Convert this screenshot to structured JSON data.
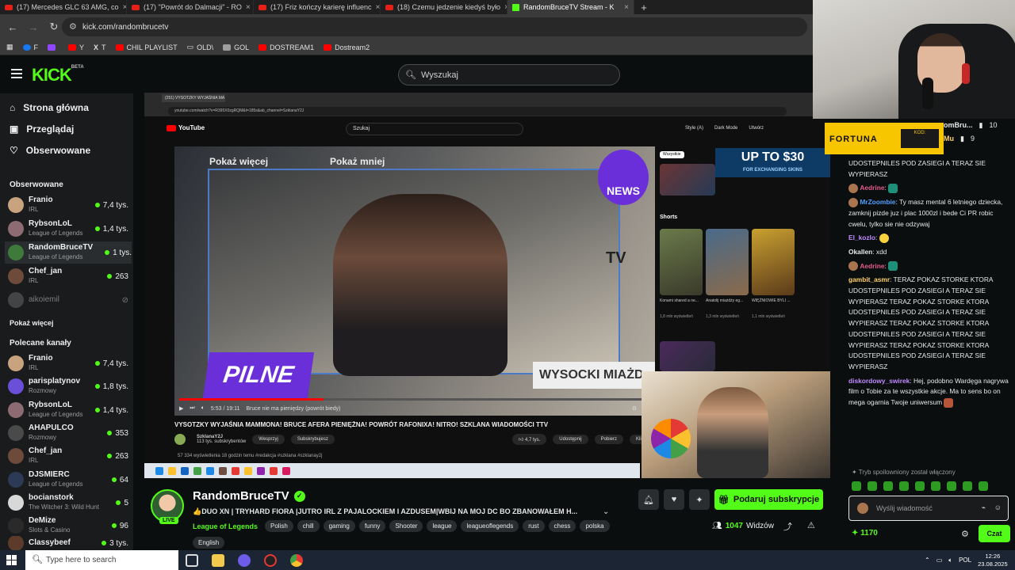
{
  "browser": {
    "tabs": [
      {
        "title": "(17) Mercedes GLC 63 AMG, co",
        "icon": "youtube"
      },
      {
        "title": "(17) \"Powrót do Dalmacji\" - RO",
        "icon": "youtube"
      },
      {
        "title": "(17) Friz kończy karierę influenc",
        "icon": "youtube"
      },
      {
        "title": "(18) Czemu jedzenie kiedyś było",
        "icon": "youtube"
      },
      {
        "title": "RandomBruceTV Stream - K",
        "icon": "kick"
      }
    ],
    "url": "kick.com/randombrucetv",
    "bookmarks": [
      {
        "label": "F",
        "color": "#1877f2"
      },
      {
        "label": "",
        "color": "#9146ff"
      },
      {
        "label": "Y",
        "color": "#ff0000"
      },
      {
        "label": "T",
        "color": "#ffffff"
      },
      {
        "label": "CHIL PLAYLIST",
        "color": "#ff0000"
      },
      {
        "label": "OLD\\",
        "color": "#cfcfcf"
      },
      {
        "label": "GOL",
        "color": "#9e9e9e"
      },
      {
        "label": "DOSTREAM1",
        "color": "#ff0000"
      },
      {
        "label": "Dostream2",
        "color": "#ff0000"
      }
    ]
  },
  "kick": {
    "logo": "KICK",
    "logo_sup": "BETA",
    "search_placeholder": "Wyszukaj",
    "nav": {
      "home": "Strona główna",
      "browse": "Przeglądaj",
      "following": "Obserwowane"
    },
    "followed_title": "Obserwowane",
    "followed": [
      {
        "name": "Franio",
        "category": "IRL",
        "viewers": "7,4 tys.",
        "live": true
      },
      {
        "name": "RybsonLoL",
        "category": "League of Legends",
        "viewers": "1,4 tys.",
        "live": true
      },
      {
        "name": "RandomBruceTV",
        "category": "League of Legends",
        "viewers": "1 tys.",
        "live": true
      },
      {
        "name": "Chef_jan",
        "category": "IRL",
        "viewers": "263",
        "live": true
      },
      {
        "name": "aikoiemil",
        "category": "",
        "viewers": "",
        "live": false
      }
    ],
    "show_more": "Pokaż więcej",
    "recommended_title": "Polecane kanały",
    "recommended": [
      {
        "name": "Franio",
        "category": "IRL",
        "viewers": "7,4 tys."
      },
      {
        "name": "parisplatynov",
        "category": "Rozmowy",
        "viewers": "1,8 tys."
      },
      {
        "name": "RybsonLoL",
        "category": "League of Legends",
        "viewers": "1,4 tys."
      },
      {
        "name": "AHAPULCO",
        "category": "Rozmowy",
        "viewers": "353"
      },
      {
        "name": "Chef_jan",
        "category": "IRL",
        "viewers": "263"
      },
      {
        "name": "DJSMIERC",
        "category": "League of Legends",
        "viewers": "64"
      },
      {
        "name": "bocianstork",
        "category": "The Witcher 3: Wild Hunt",
        "viewers": "5"
      },
      {
        "name": "DeMize",
        "category": "Slots & Casino",
        "viewers": "96"
      },
      {
        "name": "Classybeef",
        "category": "",
        "viewers": "3 tys."
      }
    ]
  },
  "video": {
    "inner_tab": "(251) VYSOTZKY WYJAŚNIA MA",
    "inner_url": "youtube.com/watch?v=R395X0zgRQM&t=185s&ab_channel=SzklanaY2J",
    "yt_search": "Szukaj",
    "yt_menu": [
      "Style (A)",
      "Dark Mode",
      "Utwórz"
    ],
    "pokaz_wiecej": "Pokaż więcej",
    "pokaz_mniej": "Pokaż mniej",
    "news": "NEWS",
    "tv": "TV",
    "pilne": "PILNE",
    "banner": "WYSOCKI MIAŻD",
    "time": "5:53 / 19:11",
    "chapter": "Bruce nie ma pieniędzy (powrót biedy)",
    "progress": 0.31,
    "title": "VYSOTZKY WYJAŚNIA MAMMONA! BRUCE AFERA PIENIĘŻNA! POWRÓT RAFONIXA! NITRO! SZKLANA WIADOMOŚCI TTV",
    "channel": "SzklanaY2J",
    "channel_subs": "113 tys. subskrybentów",
    "join": "Wesprzyj",
    "subscribed": "Subskrybujesz",
    "likes": "4,7 tys.",
    "share": "Udostępnij",
    "download": "Pobierz",
    "clip": "Klip",
    "views_line": "57 334 wyświetlenia  18 godzin temu  #redakcja #szklana #szklanay2j",
    "side_chip": "Wszystkie",
    "shorts": "Shorts",
    "short_titles": [
      "Konami shared a ne...",
      "Anatolij miażdży eg...",
      "WIĘŹNIOWIE BYLI ..."
    ],
    "short_views": [
      "1,8 mln wyświetleń",
      "1,3 mln wyświetleń",
      "1,1 mln wyświetleń"
    ],
    "promo_big": "UP TO $30",
    "promo_small": "FOR EXCHANGING SKINS"
  },
  "stream": {
    "name": "RandomBruceTV",
    "live": "LIVE",
    "title": "👍DUO XN | TRYHARD FIORA |JUTRO IRL Z PAJALOCKIEM I AZDUSEM|WBIJ NA MOJ DC BO ZBANOWAŁEM H...",
    "category": "League of Legends",
    "tags": [
      "Polish",
      "chill",
      "gaming",
      "funny",
      "Shooter",
      "league",
      "leagueoflegends",
      "rust",
      "chess",
      "polska",
      "English"
    ],
    "subscribe_button": "Podaruj subskrypcje",
    "viewers_count": "1047",
    "viewers_label": "Widzów"
  },
  "chat": {
    "top": [
      {
        "user": "omBru...",
        "badge": "10"
      },
      {
        "user": "Mu",
        "badge": "9"
      }
    ],
    "messages": [
      {
        "user": "",
        "color": "#e8e8e8",
        "text": "UDOSTEPNILES POD ZASIEGI A TERAZ SIE WYPIERASZ"
      },
      {
        "user": "Aedrine",
        "color": "#e55b8a",
        "text": "",
        "emote": true
      },
      {
        "user": "MrZoombie",
        "color": "#4ea0ff",
        "text": "Ty masz mental 6 letniego dziecka, zamknij pizde juz i plac 1000zl i bede Ci PR robic cwelu, tylko sie nie odzywaj"
      },
      {
        "user": "El_kozlo",
        "color": "#c08bff",
        "text": "",
        "emote": true
      },
      {
        "user": "Okallen",
        "color": "#e8e8e8",
        "text": "xdd"
      },
      {
        "user": "Aedrine",
        "color": "#e55b8a",
        "text": "",
        "emote": true
      },
      {
        "user": "gambit_asmr",
        "color": "#ffd166",
        "text": "TERAZ POKAZ STORKE KTORA UDOSTEPNILES POD ZASIEGI A TERAZ SIE WYPIERASZ TERAZ POKAZ STORKE KTORA UDOSTEPNILES POD ZASIEGI A TERAZ SIE WYPIERASZ TERAZ POKAZ STORKE KTORA UDOSTEPNILES POD ZASIEGI A TERAZ SIE WYPIERASZ TERAZ POKAZ STORKE KTORA UDOSTEPNILES POD ZASIEGI A TERAZ SIE WYPIERASZ"
      },
      {
        "user": "diskordowy_swirek",
        "color": "#c08bff",
        "text": "Hej, podobno Wardęga nagrywa film o Tobie za te wszystkie akcje. Ma to sens bo on mega ogarnia Twoje uniwersum",
        "emote": true
      }
    ],
    "spoiler_mode": "Tryb spoilowniony został włączony",
    "input_placeholder": "Wyślij wiadomość",
    "points": "1170",
    "send": "Czat"
  },
  "overlay": {
    "fortuna": "FORTUNA",
    "kod": "KOD:"
  },
  "taskbar": {
    "search_placeholder": "Type here to search",
    "lang": "POL",
    "time": "12:26",
    "date": "23.08.2025"
  }
}
